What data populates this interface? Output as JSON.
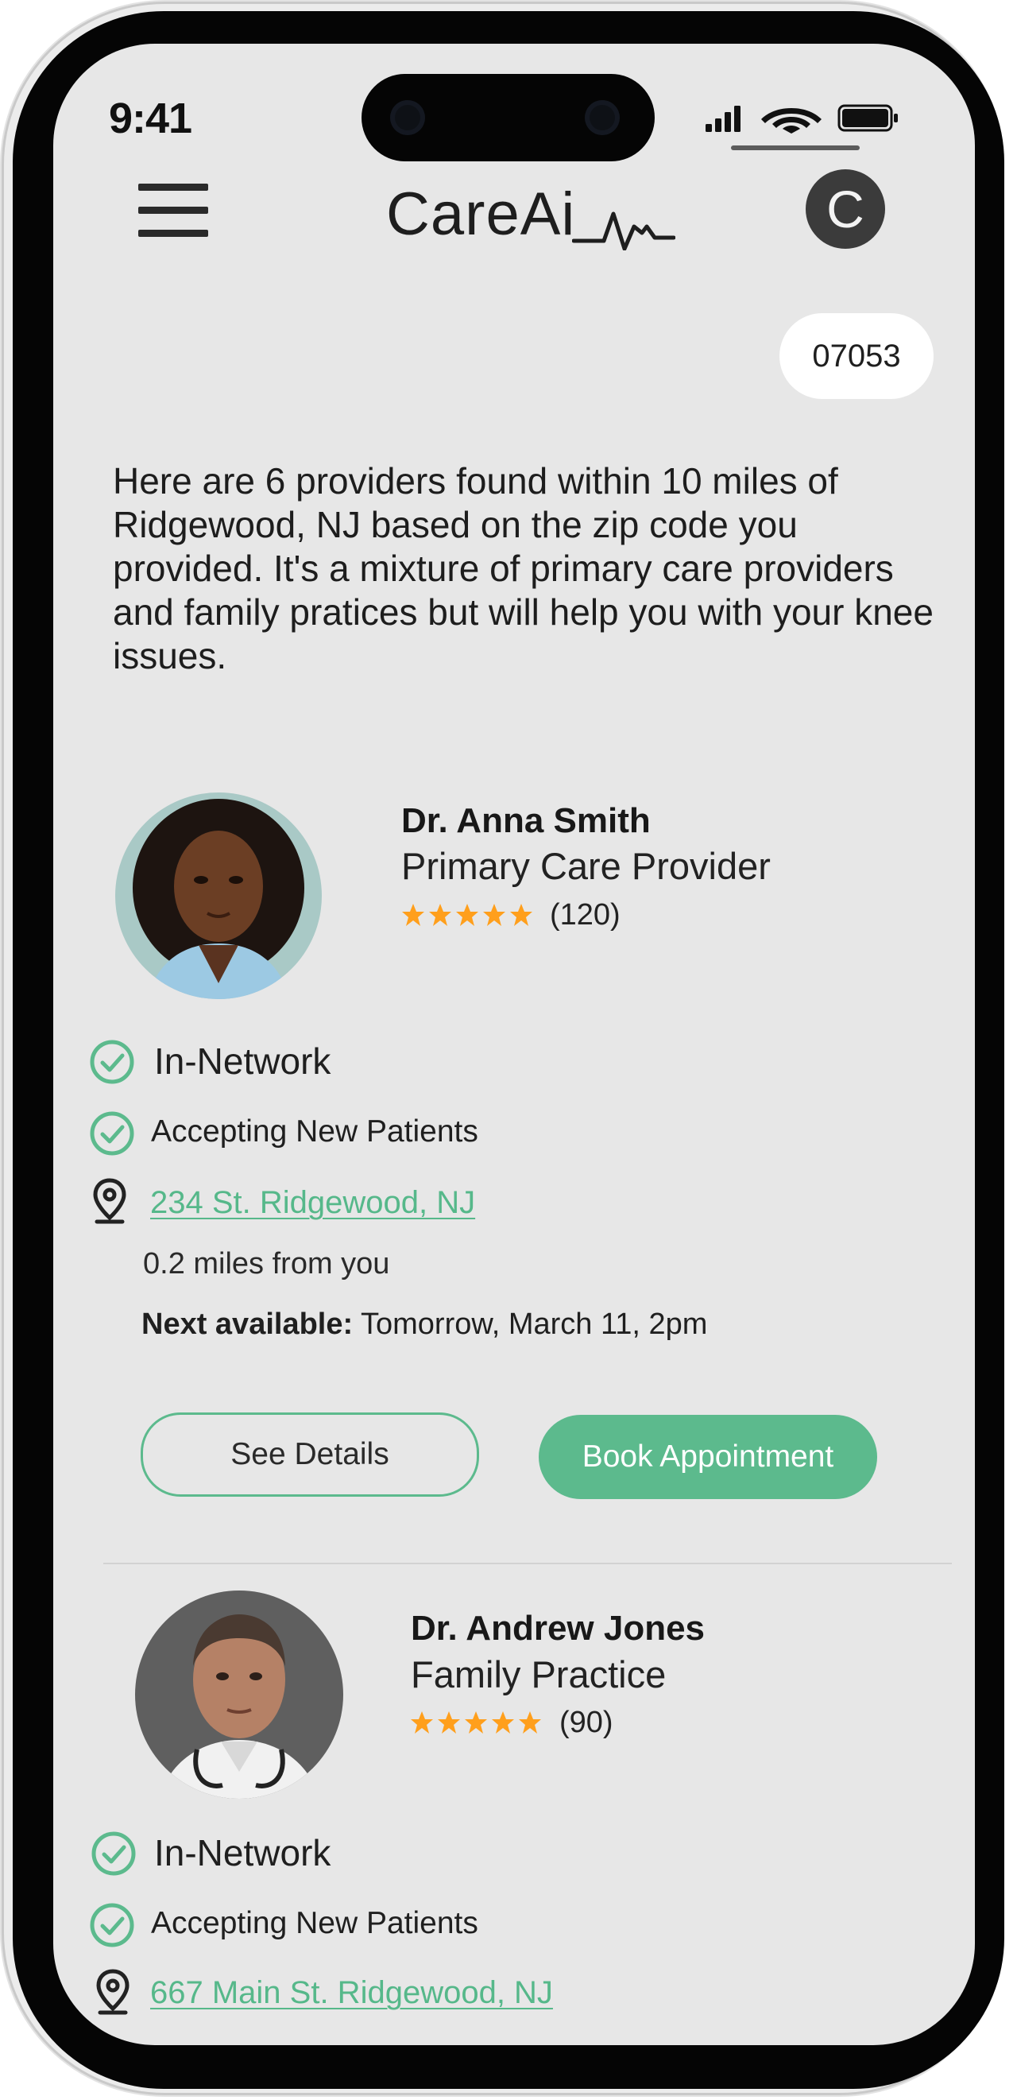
{
  "status_bar": {
    "time": "9:41"
  },
  "header": {
    "logo_text": "CareAi",
    "avatar_initial": "C"
  },
  "zip_chip": "07053",
  "assistant_message": "Here are 6 providers found within 10 miles of Ridgewood, NJ based on the zip code you provided. It's a mixture of primary care providers and family pratices but will help you with your knee issues.",
  "colors": {
    "accent": "#5cba8d",
    "star": "#ff9f1c",
    "screen_bg": "#e7e7e7"
  },
  "providers": [
    {
      "name": "Dr. Anna Smith",
      "specialty": "Primary Care Provider",
      "rating_stars": 5,
      "rating_count": "(120)",
      "network_status": "In-Network",
      "accepting": "Accepting New Patients",
      "address": "234 St. Ridgewood, NJ",
      "distance": "0.2 miles from you",
      "next_available_label": "Next available:",
      "next_available_value": " Tomorrow, March 11, 2pm",
      "see_details_label": "See Details",
      "book_label": "Book Appointment"
    },
    {
      "name": "Dr. Andrew Jones",
      "specialty": "Family Practice",
      "rating_stars": 5,
      "rating_count": "(90)",
      "network_status": "In-Network",
      "accepting": "Accepting New Patients",
      "address": "667 Main St. Ridgewood, NJ"
    }
  ]
}
